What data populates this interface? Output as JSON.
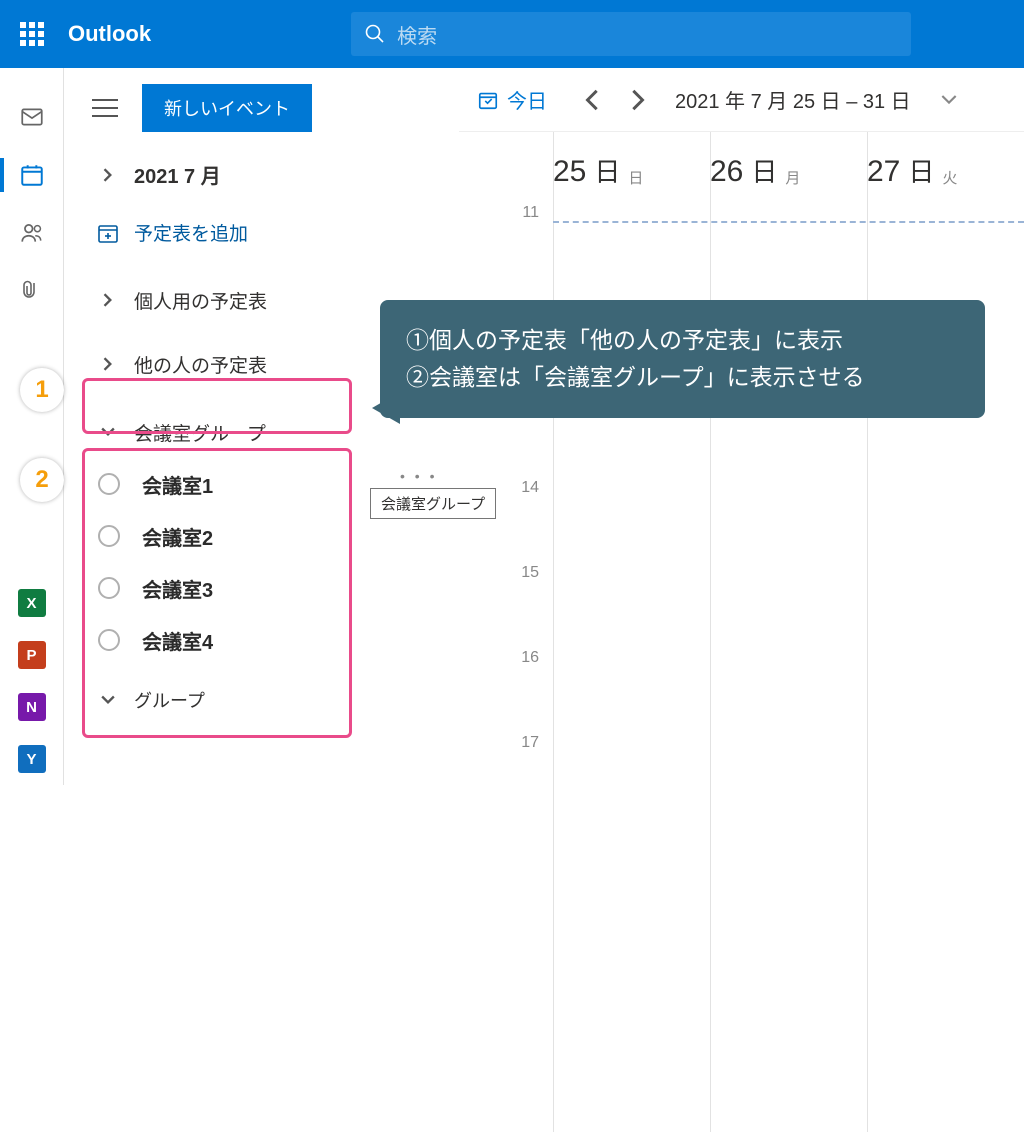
{
  "app": {
    "name": "Outlook",
    "search_placeholder": "検索"
  },
  "sidebar": {
    "new_event": "新しいイベント",
    "month": "2021 7 月",
    "add_calendar": "予定表を追加",
    "groups": {
      "personal": "個人用の予定表",
      "others": "他の人の予定表",
      "meeting_rooms": "会議室グループ",
      "groups": "グループ"
    },
    "meeting_rooms_list": [
      "会議室1",
      "会議室2",
      "会議室3",
      "会議室4"
    ]
  },
  "toolbar": {
    "today": "今日",
    "range": "2021 年 7 月 25 日 – 31 日"
  },
  "days": [
    {
      "num": "25",
      "dow": "日",
      "sub": "日"
    },
    {
      "num": "26",
      "dow": "日",
      "sub": "月"
    },
    {
      "num": "27",
      "dow": "日",
      "sub": "火"
    }
  ],
  "times": [
    "11",
    "14",
    "15",
    "16",
    "17"
  ],
  "tooltip": "会議室グループ",
  "badges": {
    "one": "1",
    "two": "2"
  },
  "callout": {
    "line1": "①個人の予定表「他の人の予定表」に表示",
    "line2": "②会議室は「会議室グループ」に表示させる"
  }
}
